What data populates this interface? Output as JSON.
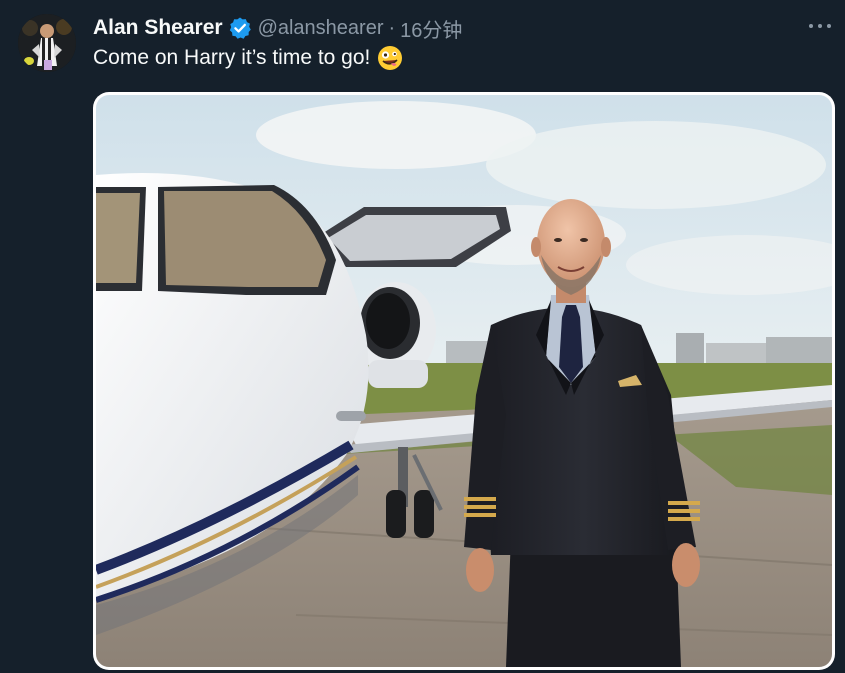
{
  "tweet": {
    "display_name": "Alan Shearer",
    "handle": "@alanshearer",
    "separator": "·",
    "timestamp": "16分钟",
    "text": "Come on Harry it’s time to go!",
    "emoji": "zany-face-emoji"
  },
  "icons": {
    "verified": "verified-badge-icon",
    "more": "more-options-icon"
  },
  "colors": {
    "background": "#15202b",
    "primary_text": "#f7f9f9",
    "secondary_text": "#8b98a5",
    "verified_badge": "#1d9bf0"
  },
  "media": {
    "description_semantic": "photo-pilot-with-private-jet"
  }
}
